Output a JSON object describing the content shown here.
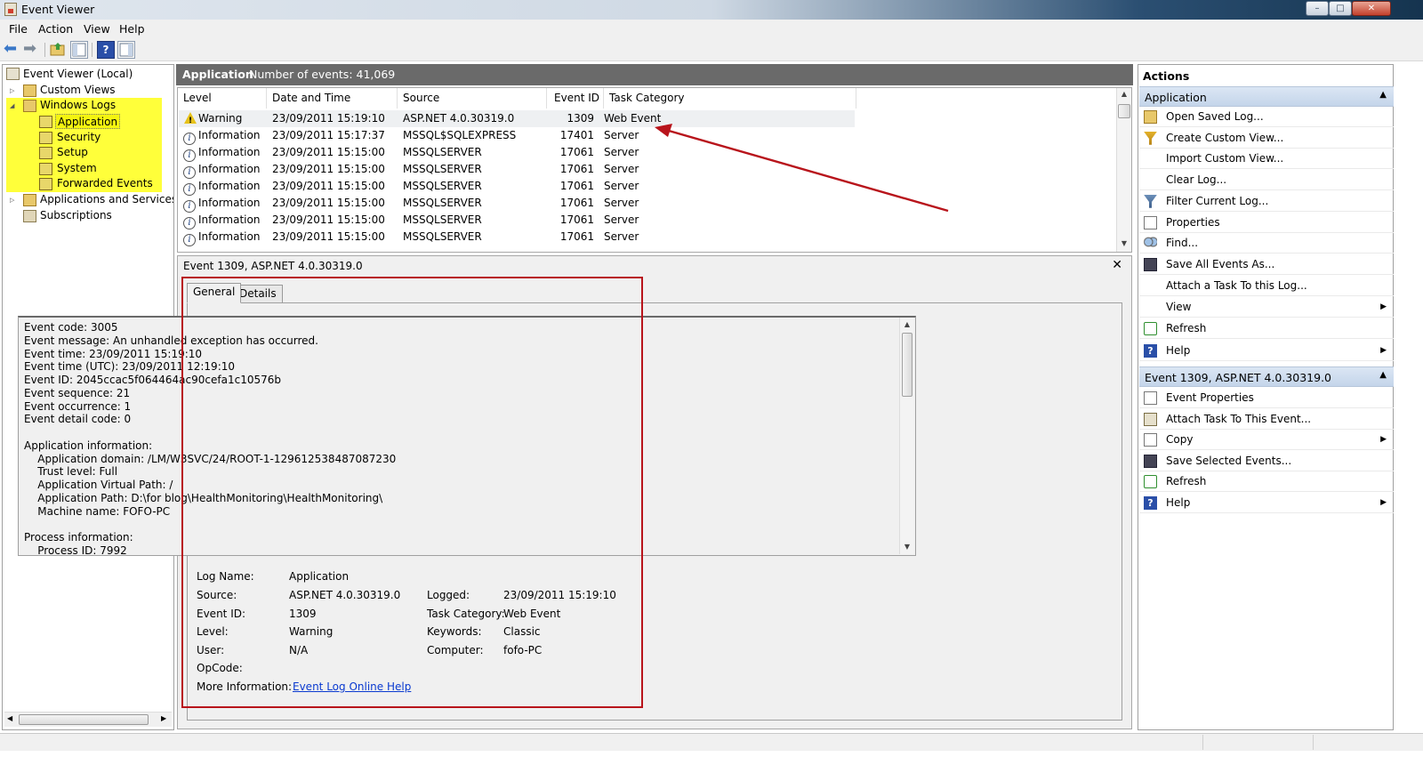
{
  "window": {
    "title": "Event Viewer",
    "minimize": "–",
    "maximize": "□",
    "close": "✕"
  },
  "menu": [
    "File",
    "Action",
    "View",
    "Help"
  ],
  "toolbar": {
    "icons": [
      "back-arrow-icon",
      "forward-arrow-icon",
      "folder-up-icon",
      "show-hide-tree-icon",
      "help-icon",
      "show-hide-action-icon"
    ]
  },
  "tree": {
    "root": "Event Viewer (Local)",
    "custom_views": "Custom Views",
    "windows_logs": "Windows Logs",
    "logs": [
      "Application",
      "Security",
      "Setup",
      "System",
      "Forwarded Events"
    ],
    "apps_services": "Applications and Services Lo",
    "subscriptions": "Subscriptions"
  },
  "log_header": {
    "name": "Application",
    "count_label": "Number of events: 41,069"
  },
  "columns": [
    "Level",
    "Date and Time",
    "Source",
    "Event ID",
    "Task Category"
  ],
  "events": [
    {
      "level": "Warning",
      "datetime": "23/09/2011 15:19:10",
      "source": "ASP.NET 4.0.30319.0",
      "id": "1309",
      "category": "Web Event"
    },
    {
      "level": "Information",
      "datetime": "23/09/2011 15:17:37",
      "source": "MSSQL$SQLEXPRESS",
      "id": "17401",
      "category": "Server"
    },
    {
      "level": "Information",
      "datetime": "23/09/2011 15:15:00",
      "source": "MSSQLSERVER",
      "id": "17061",
      "category": "Server"
    },
    {
      "level": "Information",
      "datetime": "23/09/2011 15:15:00",
      "source": "MSSQLSERVER",
      "id": "17061",
      "category": "Server"
    },
    {
      "level": "Information",
      "datetime": "23/09/2011 15:15:00",
      "source": "MSSQLSERVER",
      "id": "17061",
      "category": "Server"
    },
    {
      "level": "Information",
      "datetime": "23/09/2011 15:15:00",
      "source": "MSSQLSERVER",
      "id": "17061",
      "category": "Server"
    },
    {
      "level": "Information",
      "datetime": "23/09/2011 15:15:00",
      "source": "MSSQLSERVER",
      "id": "17061",
      "category": "Server"
    },
    {
      "level": "Information",
      "datetime": "23/09/2011 15:15:00",
      "source": "MSSQLSERVER",
      "id": "17061",
      "category": "Server"
    }
  ],
  "detail": {
    "title": "Event 1309, ASP.NET 4.0.30319.0",
    "close": "✕",
    "tabs": [
      "General",
      "Details"
    ],
    "message_lines": [
      "Event code: 3005",
      "Event message: An unhandled exception has occurred.",
      "Event time: 23/09/2011 15:19:10",
      "Event time (UTC): 23/09/2011 12:19:10",
      "Event ID: 2045ccac5f064464ac90cefa1c10576b",
      "Event sequence: 21",
      "Event occurrence: 1",
      "Event detail code: 0",
      "",
      "Application information:",
      "    Application domain: /LM/W3SVC/24/ROOT-1-129612538487087230",
      "    Trust level: Full",
      "    Application Virtual Path: /",
      "    Application Path: D:\\for blog\\HealthMonitoring\\HealthMonitoring\\",
      "    Machine name: FOFO-PC",
      "",
      "Process information:",
      "    Process ID: 7992"
    ],
    "props": {
      "log_name_label": "Log Name:",
      "log_name": "Application",
      "source_label": "Source:",
      "source": "ASP.NET 4.0.30319.0",
      "logged_label": "Logged:",
      "logged": "23/09/2011 15:19:10",
      "event_id_label": "Event ID:",
      "event_id": "1309",
      "task_label": "Task Category:",
      "task": "Web Event",
      "level_label": "Level:",
      "level": "Warning",
      "keywords_label": "Keywords:",
      "keywords": "Classic",
      "user_label": "User:",
      "user": "N/A",
      "computer_label": "Computer:",
      "computer": "fofo-PC",
      "opcode_label": "OpCode:",
      "more_label": "More Information:",
      "more_link": "Event Log Online Help"
    }
  },
  "actions": {
    "title": "Actions",
    "section1": "Application",
    "items1": [
      "Open Saved Log...",
      "Create Custom View...",
      "Import Custom View...",
      "Clear Log...",
      "Filter Current Log...",
      "Properties",
      "Find...",
      "Save All Events As...",
      "Attach a Task To this Log...",
      "View",
      "Refresh",
      "Help"
    ],
    "section2": "Event 1309, ASP.NET 4.0.30319.0",
    "items2": [
      "Event Properties",
      "Attach Task To This Event...",
      "Copy",
      "Save Selected Events...",
      "Refresh",
      "Help"
    ]
  },
  "colors": {
    "highlight": "#ffff3a",
    "annotation": "#b8141b",
    "header": "#6a6a6a",
    "link": "#0a3ad0"
  }
}
